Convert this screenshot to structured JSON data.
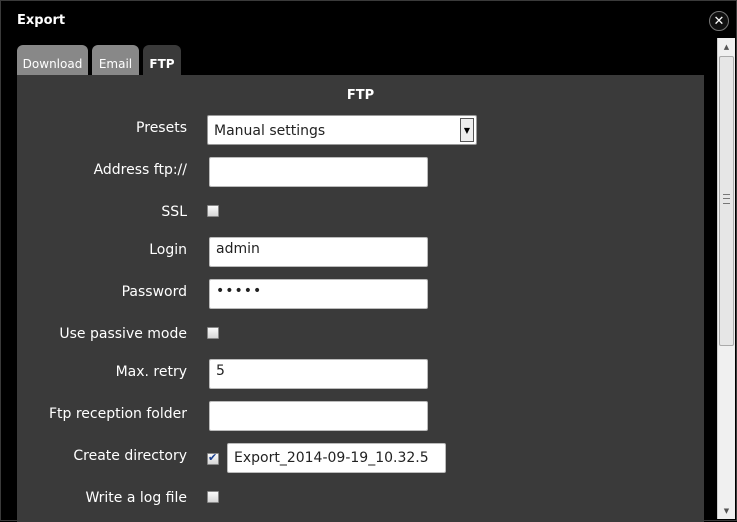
{
  "dialog": {
    "title": "Export",
    "close_icon": "close-icon"
  },
  "tabs": [
    {
      "label": "Download",
      "active": false
    },
    {
      "label": "Email",
      "active": false
    },
    {
      "label": "FTP",
      "active": true
    }
  ],
  "panel": {
    "title": "FTP",
    "presets": {
      "label": "Presets",
      "value": "Manual settings"
    },
    "address": {
      "label": "Address ftp://",
      "value": ""
    },
    "ssl": {
      "label": "SSL",
      "checked": false
    },
    "login": {
      "label": "Login",
      "value": "admin"
    },
    "password": {
      "label": "Password",
      "value": "•••••"
    },
    "passive": {
      "label": "Use passive mode",
      "checked": false
    },
    "max_retry": {
      "label": "Max. retry",
      "value": "5"
    },
    "reception_folder": {
      "label": "Ftp reception folder",
      "value": ""
    },
    "create_directory": {
      "label": "Create directory",
      "checked": true,
      "value": "Export_2014-09-19_10.32.5"
    },
    "log_file": {
      "label": "Write a log file",
      "checked": false
    }
  },
  "colors": {
    "panel_bg": "#3a3a3a",
    "tab_inactive": "#888888",
    "window_bg": "#000000"
  }
}
